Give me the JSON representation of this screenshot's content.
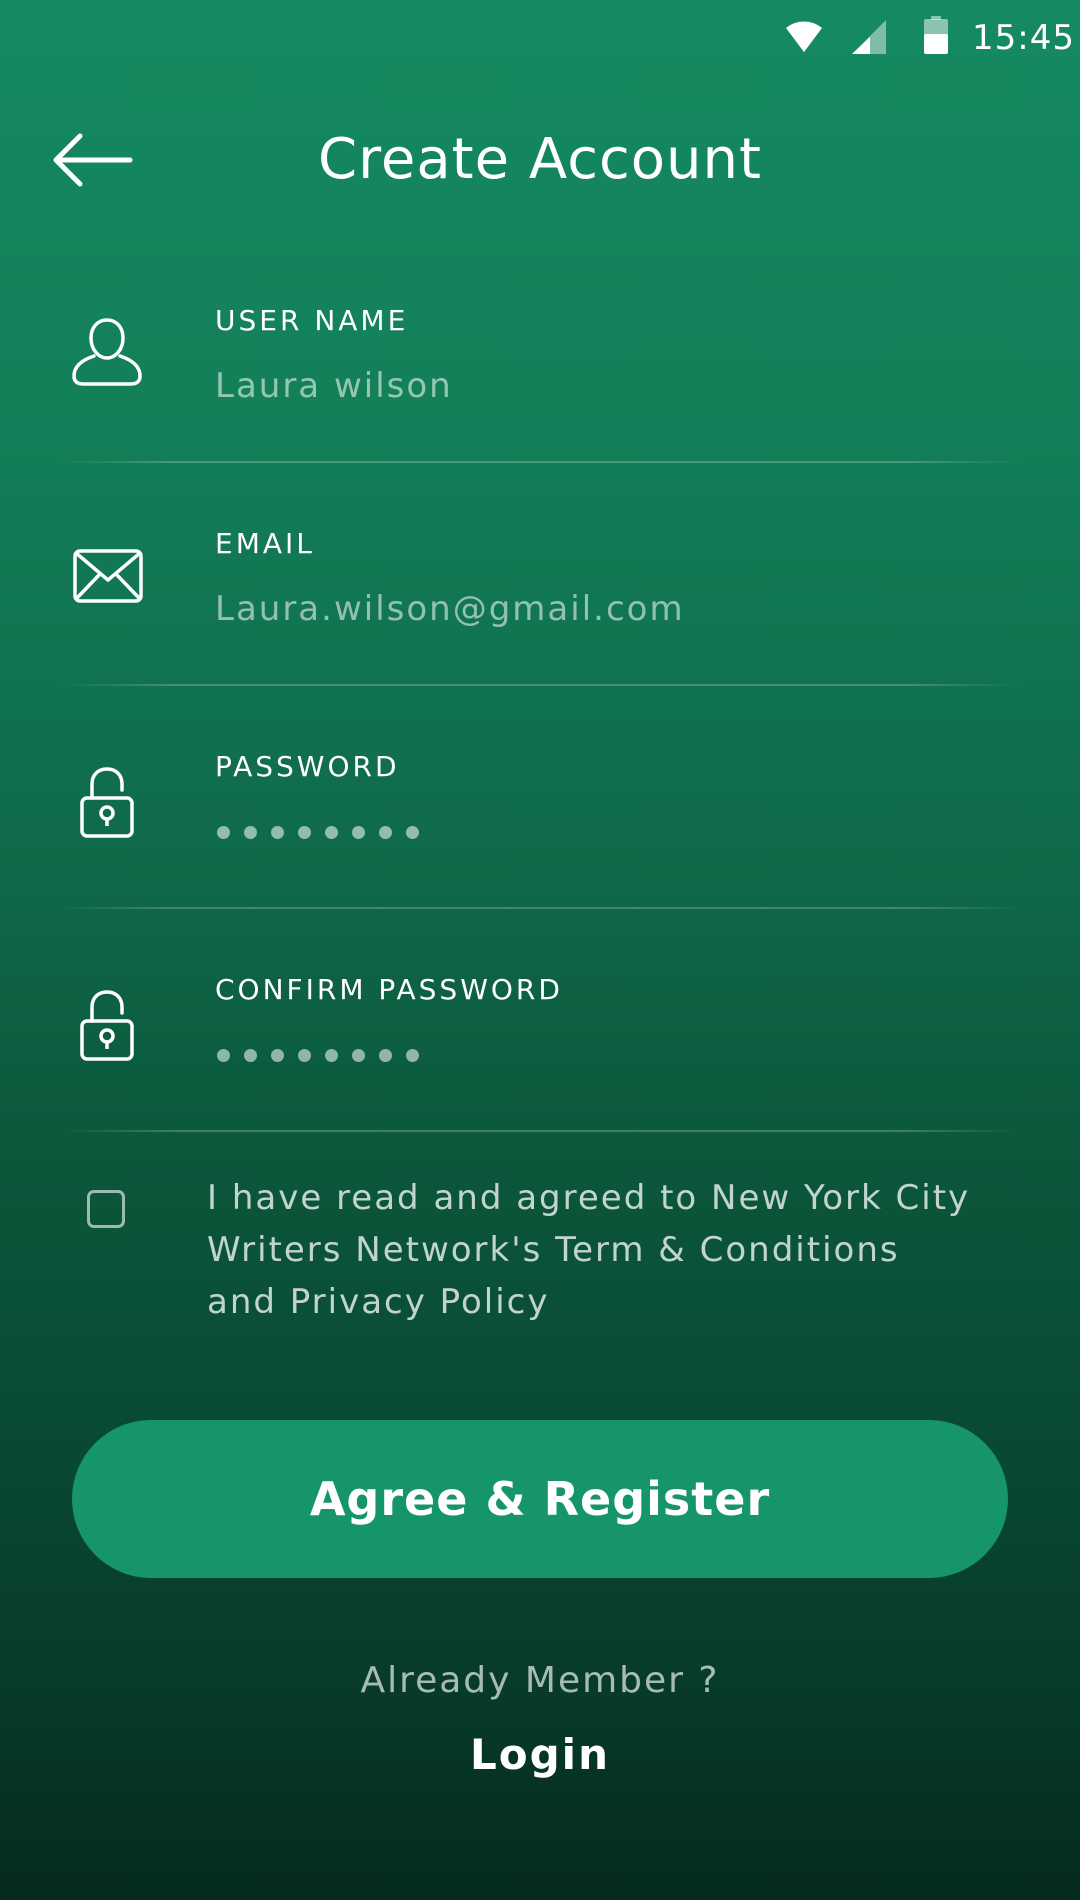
{
  "status_bar": {
    "time": "15:45",
    "icons": [
      "wifi-icon",
      "signal-icon",
      "battery-icon"
    ]
  },
  "header": {
    "title": "Create Account",
    "back_icon": "arrow-left-icon"
  },
  "form": {
    "fields": [
      {
        "label": "USER NAME",
        "value": "Laura wilson",
        "icon": "user-icon"
      },
      {
        "label": "EMAIL",
        "value": "Laura.wilson@gmail.com",
        "icon": "mail-icon"
      },
      {
        "label": "PASSWORD",
        "masked_length": 8,
        "icon": "lock-icon"
      },
      {
        "label": "CONFIRM PASSWORD",
        "masked_length": 8,
        "icon": "lock-icon"
      }
    ]
  },
  "terms": {
    "checked": false,
    "line1": "I have read and agreed to New York City",
    "line2": "Writers Network's Term & Conditions",
    "line3": "and Privacy Policy"
  },
  "actions": {
    "register_label": "Agree & Register",
    "already_member": "Already Member ?",
    "login_label": "Login"
  },
  "colors": {
    "background_top": "#158a60",
    "background_bottom": "#052a1e",
    "button": "#16956a",
    "text": "#ffffff"
  }
}
